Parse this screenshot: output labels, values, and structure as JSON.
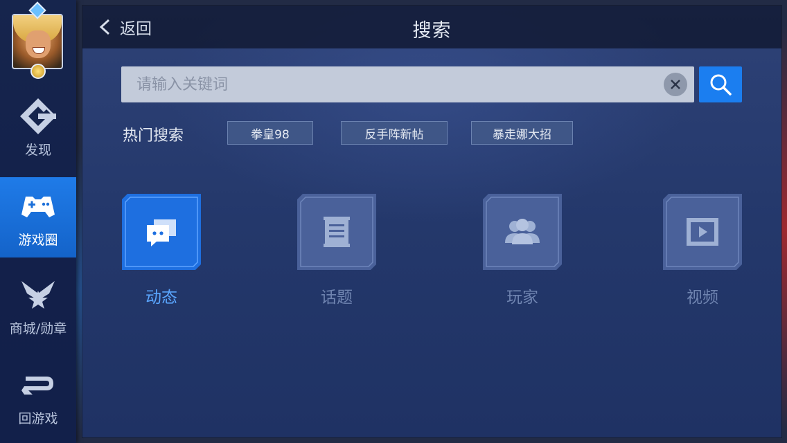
{
  "sidebar": {
    "items": [
      {
        "label": "发现",
        "icon": "discover-icon"
      },
      {
        "label": "游戏圈",
        "icon": "gamepad-icon"
      },
      {
        "label": "商城/勋章",
        "icon": "shop-medal-icon"
      },
      {
        "label": "回游戏",
        "icon": "return-game-icon"
      }
    ],
    "active_index": 1
  },
  "header": {
    "back_label": "返回",
    "title": "搜索"
  },
  "search": {
    "placeholder": "请输入关键词",
    "value": ""
  },
  "hot": {
    "label": "热门搜索",
    "tags": [
      "拳皇98",
      "反手阵新帖",
      "暴走娜大招"
    ]
  },
  "categories": [
    {
      "label": "动态",
      "icon": "chat-bubbles-icon",
      "active": true
    },
    {
      "label": "话题",
      "icon": "scroll-list-icon",
      "active": false
    },
    {
      "label": "玩家",
      "icon": "players-icon",
      "active": false
    },
    {
      "label": "视频",
      "icon": "video-play-icon",
      "active": false
    }
  ],
  "colors": {
    "accent": "#1b7ef0",
    "active_label": "#5aa6ff",
    "inactive_label": "#6f84b0"
  }
}
